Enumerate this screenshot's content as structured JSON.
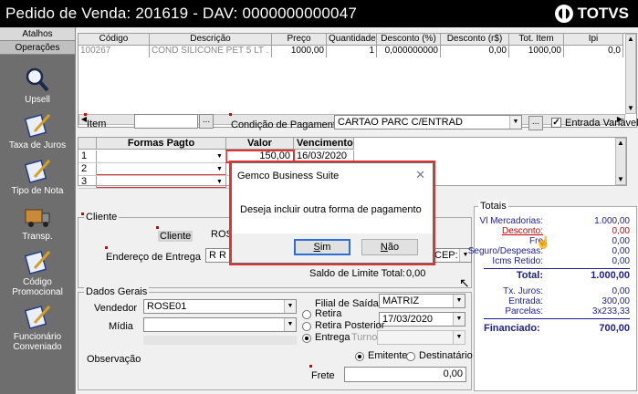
{
  "window": {
    "title": "Pedido de Venda: 201619  - DAV: 0000000000047",
    "brand": "TOTVS"
  },
  "sidebar": {
    "tabs": [
      "Atalhos",
      "Operações"
    ],
    "items": [
      {
        "label": "Upsell",
        "icon": "magnifier-icon"
      },
      {
        "label": "Taxa de Juros",
        "icon": "notepad-pen-icon"
      },
      {
        "label": "Tipo de Nota",
        "icon": "notepad-pen-icon"
      },
      {
        "label": "Transp.",
        "icon": "truck-icon"
      },
      {
        "label": "Código Promocional",
        "icon": "notepad-pen-icon"
      },
      {
        "label": "Funcionário Conveniado",
        "icon": "notepad-pen-icon"
      }
    ]
  },
  "items_grid": {
    "columns": [
      "Código",
      "Descrição",
      "Preço",
      "Quantidade",
      "Desconto (%)",
      "Desconto (r$)",
      "Tot. Item",
      "Ipi"
    ],
    "row": [
      "100267",
      "COND SILICONE PET 5 LT . . .",
      "1000,00",
      "1",
      "0,000000000",
      "0,00",
      "1000,00",
      "0,0"
    ]
  },
  "form": {
    "item_label": "Item",
    "item_value": "",
    "condicao_label": "Condição de Pagamento",
    "condicao_value": "CARTAO PARC C/ENTRAD",
    "entrada_label": "Entrada Variável",
    "entrada_checked": "✓"
  },
  "payments_grid": {
    "columns": [
      "Formas Pagto",
      "Valor",
      "Vencimento"
    ],
    "rows": [
      {
        "n": "1",
        "forma": "",
        "valor": "150,00",
        "venc": "16/03/2020"
      },
      {
        "n": "2",
        "forma": "",
        "valor": "",
        "venc": ""
      },
      {
        "n": "3",
        "forma": "",
        "valor": "",
        "venc": ""
      }
    ]
  },
  "cliente": {
    "group_label": "Cliente",
    "cliente_label": "Cliente",
    "cliente_value": "ROSE",
    "endereco_label": "Endereço de Entrega",
    "endereco_value": "R R",
    "cep_label": "CEP:",
    "saldo_label": "Saldo de Limite Total:",
    "saldo_value": "0,00"
  },
  "dados_gerais": {
    "group_label": "Dados Gerais",
    "vendedor_label": "Vendedor",
    "vendedor_value": "ROSE01",
    "midia_label": "Mídia",
    "midia_value": "",
    "observacao_label": "Observação",
    "filial_label": "Filial de Saída",
    "filial_value": "MATRIZ",
    "retira_label": "Retira",
    "retira_date": "17/03/2020",
    "retira_posterior_label": "Retira Posterior",
    "entrega_label": "Entrega",
    "turno_label": "Turno",
    "emitente_label": "Emitente",
    "destinatario_label": "Destinatário",
    "frete_label": "Frete",
    "frete_value": "0,00"
  },
  "totais": {
    "group_label": "Totais",
    "rows": [
      {
        "k": "Vl Mercadorias:",
        "v": "1.000,00"
      },
      {
        "k": "Desconto:",
        "v": "0,00"
      },
      {
        "k": "Fre",
        "v": "0,00"
      },
      {
        "k": "Seguro/Despesas:",
        "v": "0,00"
      },
      {
        "k": "Icms Retido:",
        "v": "0,00"
      }
    ],
    "total_label": "Total:",
    "total_value": "1.000,00",
    "rows2": [
      {
        "k": "Tx. Juros:",
        "v": "0,00"
      },
      {
        "k": "Entrada:",
        "v": "300,00"
      },
      {
        "k": "Parcelas:",
        "v": "3x233,33"
      }
    ],
    "financiado_label": "Financiado:",
    "financiado_value": "700,00"
  },
  "dialog": {
    "title": "Gemco Business Suite",
    "close": "✕",
    "message": "Deseja incluir outra forma de pagamento",
    "yes": "Sim",
    "no": "Não"
  },
  "colors": {
    "highlight": "#d33333",
    "totals_text": "#1c1f8f",
    "discount_red": "#d00000"
  }
}
